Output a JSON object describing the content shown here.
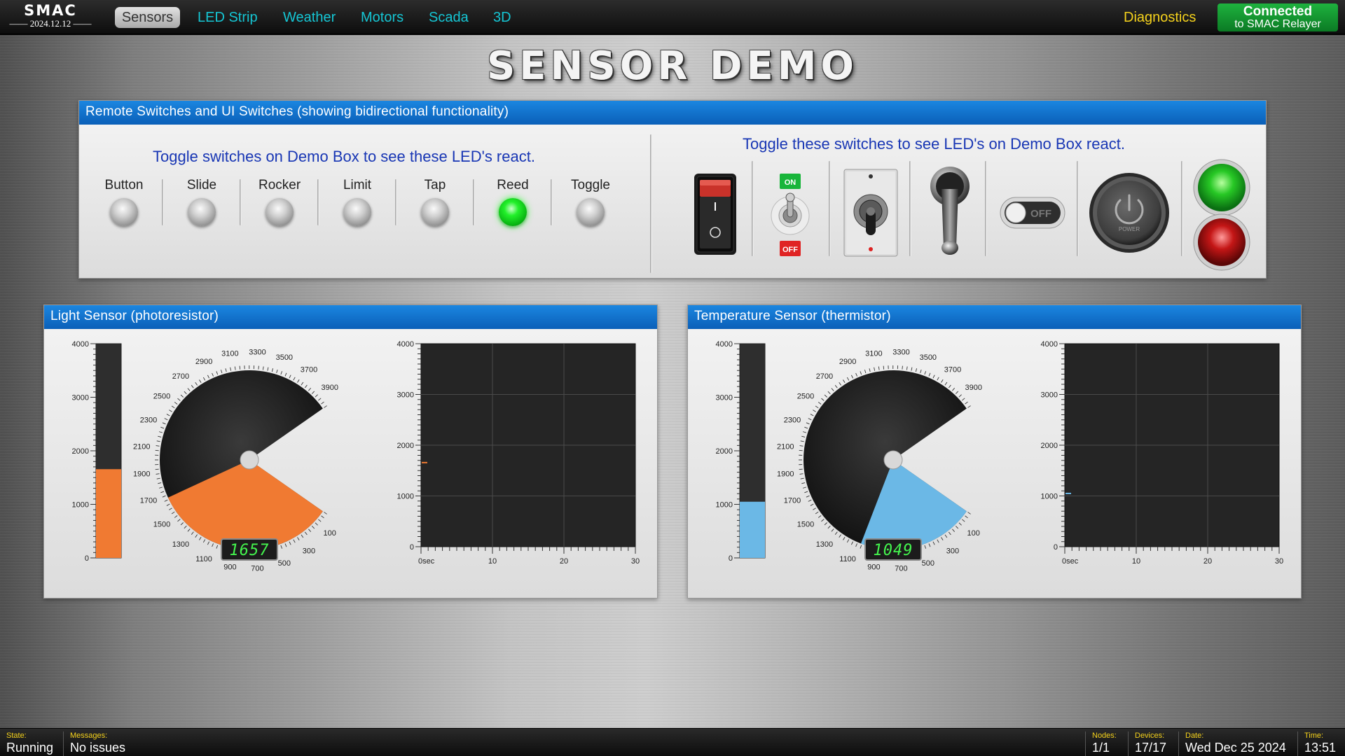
{
  "header": {
    "logo_text": "SMAC",
    "version": "2024.12.12",
    "nav": [
      "Sensors",
      "LED Strip",
      "Weather",
      "Motors",
      "Scada",
      "3D"
    ],
    "active_nav": "Sensors",
    "diagnostics": "Diagnostics",
    "connection": {
      "line1": "Connected",
      "line2": "to SMAC Relayer",
      "color": "#14a035"
    }
  },
  "page_title": "SENSOR DEMO",
  "switch_panel": {
    "title": "Remote Switches and UI Switches (showing bidirectional functionality)",
    "left_caption": "Toggle switches on Demo Box to see these LED's react.",
    "right_caption": "Toggle these switches to see LED's on Demo Box react.",
    "leds": [
      {
        "label": "Button",
        "on": false
      },
      {
        "label": "Slide",
        "on": false
      },
      {
        "label": "Rocker",
        "on": false
      },
      {
        "label": "Limit",
        "on": false
      },
      {
        "label": "Tap",
        "on": false
      },
      {
        "label": "Reed",
        "on": true
      },
      {
        "label": "Toggle",
        "on": false
      }
    ],
    "controls": {
      "rocker_switch": {
        "state": "off",
        "marks": "I / O"
      },
      "toggle_switch": {
        "on_label": "ON",
        "off_label": "OFF",
        "state": "on"
      },
      "bat_toggle": {
        "state": "down"
      },
      "lever_switch": {
        "state": "up"
      },
      "slider_toggle": {
        "label": "OFF",
        "state": "off"
      },
      "power_button": {
        "label": "POWER"
      },
      "green_button": {
        "color": "#1ec31e"
      },
      "red_button": {
        "color": "#c41616"
      }
    }
  },
  "light_sensor": {
    "title": "Light Sensor (photoresistor)",
    "value": 1657,
    "display": "1657",
    "color": "#f07a32",
    "bar_ticks": [
      "0",
      "1000",
      "2000",
      "3000",
      "4000"
    ],
    "gauge_labels": [
      "100",
      "300",
      "500",
      "700",
      "900",
      "1100",
      "1300",
      "1500",
      "1700",
      "1900",
      "2100",
      "2300",
      "2500",
      "2700",
      "2900",
      "3100",
      "3300",
      "3500",
      "3700",
      "3900"
    ],
    "chart_data": {
      "type": "line",
      "x_label_first": "0sec",
      "x_ticks": [
        "0sec",
        "10",
        "20",
        "30"
      ],
      "y_ticks": [
        "0",
        "1000",
        "2000",
        "3000",
        "4000"
      ],
      "xlim": [
        0,
        30
      ],
      "ylim": [
        0,
        4000
      ],
      "grid": true,
      "series": [
        {
          "values": [
            {
              "x": 0,
              "y": 1657
            }
          ]
        }
      ]
    }
  },
  "temperature_sensor": {
    "title": "Temperature Sensor (thermistor)",
    "value": 1049,
    "display": "1049",
    "color": "#6bb8e6",
    "bar_ticks": [
      "0",
      "1000",
      "2000",
      "3000",
      "4000"
    ],
    "gauge_labels": [
      "100",
      "300",
      "500",
      "700",
      "900",
      "1100",
      "1300",
      "1500",
      "1700",
      "1900",
      "2100",
      "2300",
      "2500",
      "2700",
      "2900",
      "3100",
      "3300",
      "3500",
      "3700",
      "3900"
    ],
    "chart_data": {
      "type": "line",
      "x_ticks": [
        "0sec",
        "10",
        "20",
        "30"
      ],
      "y_ticks": [
        "0",
        "1000",
        "2000",
        "3000",
        "4000"
      ],
      "xlim": [
        0,
        30
      ],
      "ylim": [
        0,
        4000
      ],
      "grid": true,
      "series": [
        {
          "values": [
            {
              "x": 0,
              "y": 1049
            }
          ]
        }
      ]
    }
  },
  "status_bar": {
    "state_label": "State:",
    "state": "Running",
    "messages_label": "Messages:",
    "messages": "No issues",
    "nodes_label": "Nodes:",
    "nodes": "1/1",
    "devices_label": "Devices:",
    "devices": "17/17",
    "date_label": "Date:",
    "date": "Wed Dec 25 2024",
    "time_label": "Time:",
    "time": "13:51"
  }
}
